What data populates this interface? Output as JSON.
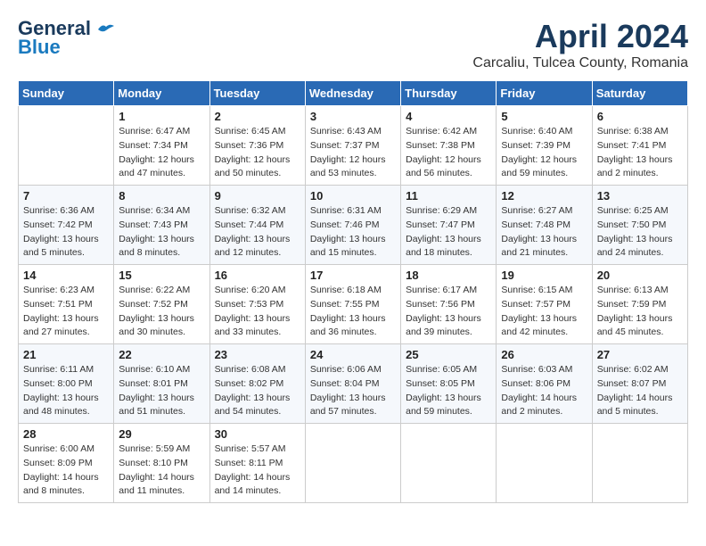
{
  "logo": {
    "line1": "General",
    "line2": "Blue"
  },
  "title": "April 2024",
  "subtitle": "Carcaliu, Tulcea County, Romania",
  "days_of_week": [
    "Sunday",
    "Monday",
    "Tuesday",
    "Wednesday",
    "Thursday",
    "Friday",
    "Saturday"
  ],
  "weeks": [
    [
      {
        "day": "",
        "info": ""
      },
      {
        "day": "1",
        "info": "Sunrise: 6:47 AM\nSunset: 7:34 PM\nDaylight: 12 hours\nand 47 minutes."
      },
      {
        "day": "2",
        "info": "Sunrise: 6:45 AM\nSunset: 7:36 PM\nDaylight: 12 hours\nand 50 minutes."
      },
      {
        "day": "3",
        "info": "Sunrise: 6:43 AM\nSunset: 7:37 PM\nDaylight: 12 hours\nand 53 minutes."
      },
      {
        "day": "4",
        "info": "Sunrise: 6:42 AM\nSunset: 7:38 PM\nDaylight: 12 hours\nand 56 minutes."
      },
      {
        "day": "5",
        "info": "Sunrise: 6:40 AM\nSunset: 7:39 PM\nDaylight: 12 hours\nand 59 minutes."
      },
      {
        "day": "6",
        "info": "Sunrise: 6:38 AM\nSunset: 7:41 PM\nDaylight: 13 hours\nand 2 minutes."
      }
    ],
    [
      {
        "day": "7",
        "info": "Sunrise: 6:36 AM\nSunset: 7:42 PM\nDaylight: 13 hours\nand 5 minutes."
      },
      {
        "day": "8",
        "info": "Sunrise: 6:34 AM\nSunset: 7:43 PM\nDaylight: 13 hours\nand 8 minutes."
      },
      {
        "day": "9",
        "info": "Sunrise: 6:32 AM\nSunset: 7:44 PM\nDaylight: 13 hours\nand 12 minutes."
      },
      {
        "day": "10",
        "info": "Sunrise: 6:31 AM\nSunset: 7:46 PM\nDaylight: 13 hours\nand 15 minutes."
      },
      {
        "day": "11",
        "info": "Sunrise: 6:29 AM\nSunset: 7:47 PM\nDaylight: 13 hours\nand 18 minutes."
      },
      {
        "day": "12",
        "info": "Sunrise: 6:27 AM\nSunset: 7:48 PM\nDaylight: 13 hours\nand 21 minutes."
      },
      {
        "day": "13",
        "info": "Sunrise: 6:25 AM\nSunset: 7:50 PM\nDaylight: 13 hours\nand 24 minutes."
      }
    ],
    [
      {
        "day": "14",
        "info": "Sunrise: 6:23 AM\nSunset: 7:51 PM\nDaylight: 13 hours\nand 27 minutes."
      },
      {
        "day": "15",
        "info": "Sunrise: 6:22 AM\nSunset: 7:52 PM\nDaylight: 13 hours\nand 30 minutes."
      },
      {
        "day": "16",
        "info": "Sunrise: 6:20 AM\nSunset: 7:53 PM\nDaylight: 13 hours\nand 33 minutes."
      },
      {
        "day": "17",
        "info": "Sunrise: 6:18 AM\nSunset: 7:55 PM\nDaylight: 13 hours\nand 36 minutes."
      },
      {
        "day": "18",
        "info": "Sunrise: 6:17 AM\nSunset: 7:56 PM\nDaylight: 13 hours\nand 39 minutes."
      },
      {
        "day": "19",
        "info": "Sunrise: 6:15 AM\nSunset: 7:57 PM\nDaylight: 13 hours\nand 42 minutes."
      },
      {
        "day": "20",
        "info": "Sunrise: 6:13 AM\nSunset: 7:59 PM\nDaylight: 13 hours\nand 45 minutes."
      }
    ],
    [
      {
        "day": "21",
        "info": "Sunrise: 6:11 AM\nSunset: 8:00 PM\nDaylight: 13 hours\nand 48 minutes."
      },
      {
        "day": "22",
        "info": "Sunrise: 6:10 AM\nSunset: 8:01 PM\nDaylight: 13 hours\nand 51 minutes."
      },
      {
        "day": "23",
        "info": "Sunrise: 6:08 AM\nSunset: 8:02 PM\nDaylight: 13 hours\nand 54 minutes."
      },
      {
        "day": "24",
        "info": "Sunrise: 6:06 AM\nSunset: 8:04 PM\nDaylight: 13 hours\nand 57 minutes."
      },
      {
        "day": "25",
        "info": "Sunrise: 6:05 AM\nSunset: 8:05 PM\nDaylight: 13 hours\nand 59 minutes."
      },
      {
        "day": "26",
        "info": "Sunrise: 6:03 AM\nSunset: 8:06 PM\nDaylight: 14 hours\nand 2 minutes."
      },
      {
        "day": "27",
        "info": "Sunrise: 6:02 AM\nSunset: 8:07 PM\nDaylight: 14 hours\nand 5 minutes."
      }
    ],
    [
      {
        "day": "28",
        "info": "Sunrise: 6:00 AM\nSunset: 8:09 PM\nDaylight: 14 hours\nand 8 minutes."
      },
      {
        "day": "29",
        "info": "Sunrise: 5:59 AM\nSunset: 8:10 PM\nDaylight: 14 hours\nand 11 minutes."
      },
      {
        "day": "30",
        "info": "Sunrise: 5:57 AM\nSunset: 8:11 PM\nDaylight: 14 hours\nand 14 minutes."
      },
      {
        "day": "",
        "info": ""
      },
      {
        "day": "",
        "info": ""
      },
      {
        "day": "",
        "info": ""
      },
      {
        "day": "",
        "info": ""
      }
    ]
  ]
}
